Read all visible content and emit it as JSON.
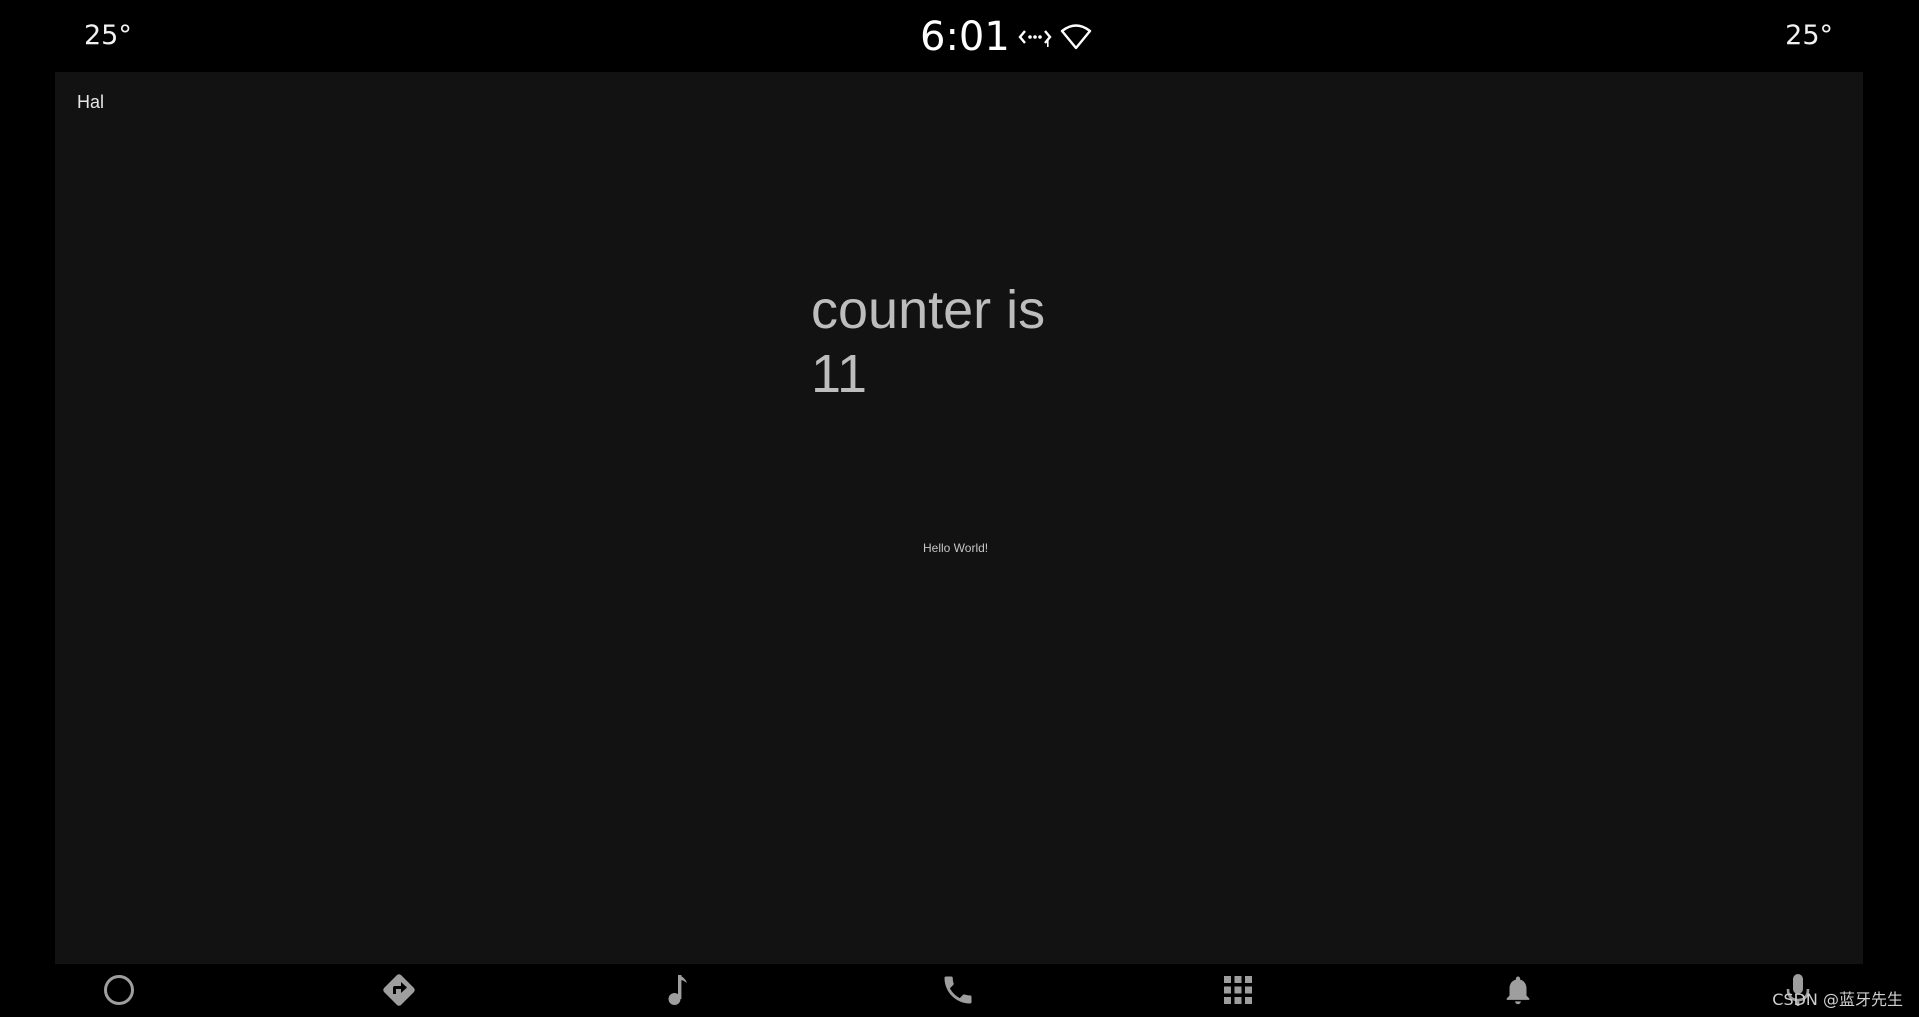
{
  "status_bar": {
    "temp_left": "25°",
    "temp_right": "25°",
    "clock": "6:01",
    "icons": [
      "data-sync-icon",
      "wifi-icon"
    ]
  },
  "app": {
    "title": "Hal",
    "counter_label": "counter is 11",
    "hello": "Hello World!"
  },
  "nav_bar": {
    "items": [
      {
        "icon": "home-circle-icon"
      },
      {
        "icon": "navigation-directions-icon"
      },
      {
        "icon": "music-note-icon"
      },
      {
        "icon": "phone-icon"
      },
      {
        "icon": "app-grid-icon"
      },
      {
        "icon": "notification-bell-icon"
      },
      {
        "icon": "microphone-icon"
      }
    ]
  },
  "watermark": "CSDN @蓝牙先生",
  "colors": {
    "background": "#000000",
    "app_surface": "#121212",
    "nav_icon": "#9e9e9e",
    "counter_text": "#bdbdbd"
  }
}
